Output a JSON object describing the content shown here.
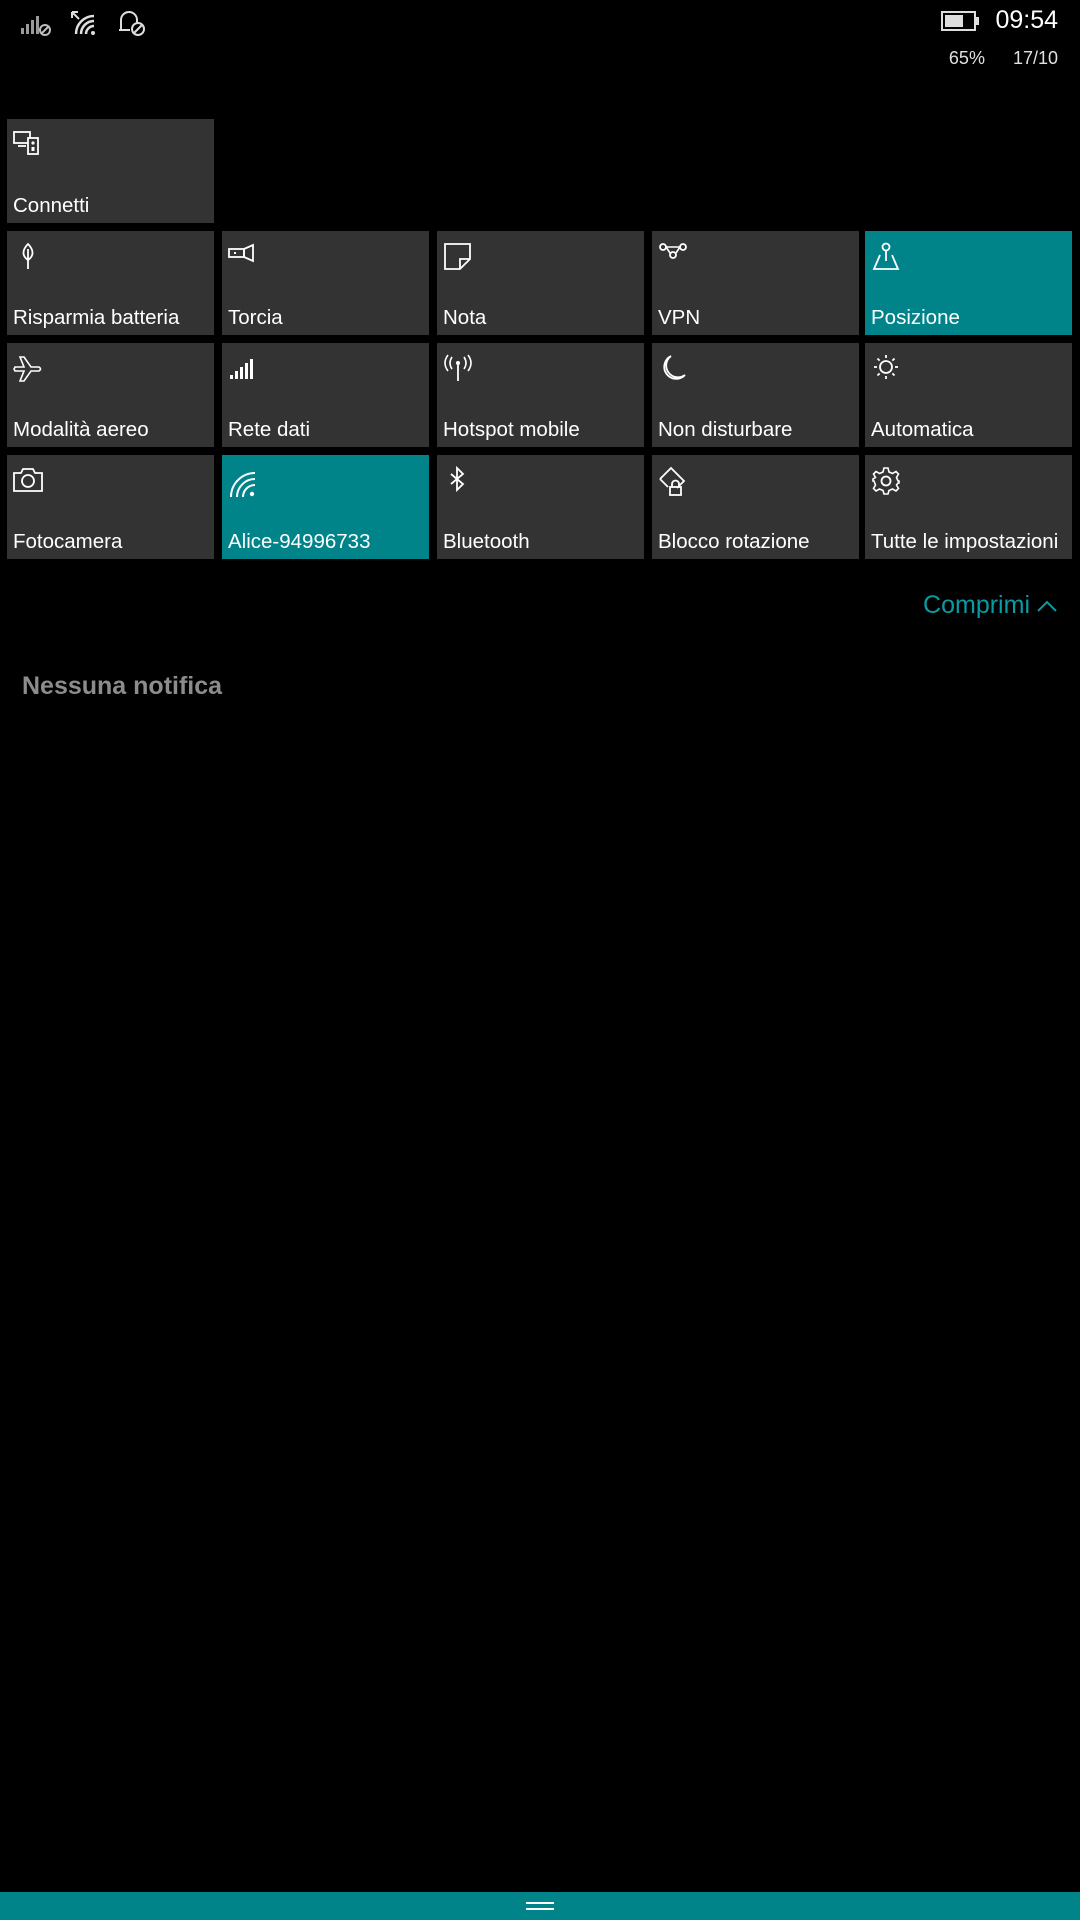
{
  "status": {
    "time": "09:54",
    "battery_percent": "65%",
    "date": "17/10",
    "icons": [
      "signal-off-icon",
      "wifi-icon",
      "notifications-off-icon",
      "battery-icon"
    ]
  },
  "tiles": [
    {
      "label": "Connetti",
      "icon": "connect-icon",
      "active": false
    },
    {
      "label": "Risparmia batteria",
      "icon": "battery-saver-icon",
      "active": false
    },
    {
      "label": "Torcia",
      "icon": "flashlight-icon",
      "active": false
    },
    {
      "label": "Nota",
      "icon": "note-icon",
      "active": false
    },
    {
      "label": "VPN",
      "icon": "vpn-icon",
      "active": false
    },
    {
      "label": "Posizione",
      "icon": "location-icon",
      "active": true
    },
    {
      "label": "Modalità aereo",
      "icon": "airplane-icon",
      "active": false
    },
    {
      "label": "Rete dati",
      "icon": "cellular-icon",
      "active": false
    },
    {
      "label": "Hotspot mobile",
      "icon": "hotspot-icon",
      "active": false
    },
    {
      "label": "Non disturbare",
      "icon": "moon-icon",
      "active": false
    },
    {
      "label": "Automatica",
      "icon": "brightness-icon",
      "active": false
    },
    {
      "label": "Fotocamera",
      "icon": "camera-icon",
      "active": false
    },
    {
      "label": "Alice-94996733",
      "icon": "wifi-icon",
      "active": true
    },
    {
      "label": "Bluetooth",
      "icon": "bluetooth-icon",
      "active": false
    },
    {
      "label": "Blocco rotazione",
      "icon": "rotation-lock-icon",
      "active": false
    },
    {
      "label": "Tutte le impostazioni",
      "icon": "settings-gear-icon",
      "active": false
    }
  ],
  "collapse_label": "Comprimi",
  "no_notifications": "Nessuna notifica",
  "colors": {
    "accent": "#00848a",
    "accent_text": "#0a9aa3",
    "tile_bg": "#333333",
    "background": "#000000"
  }
}
